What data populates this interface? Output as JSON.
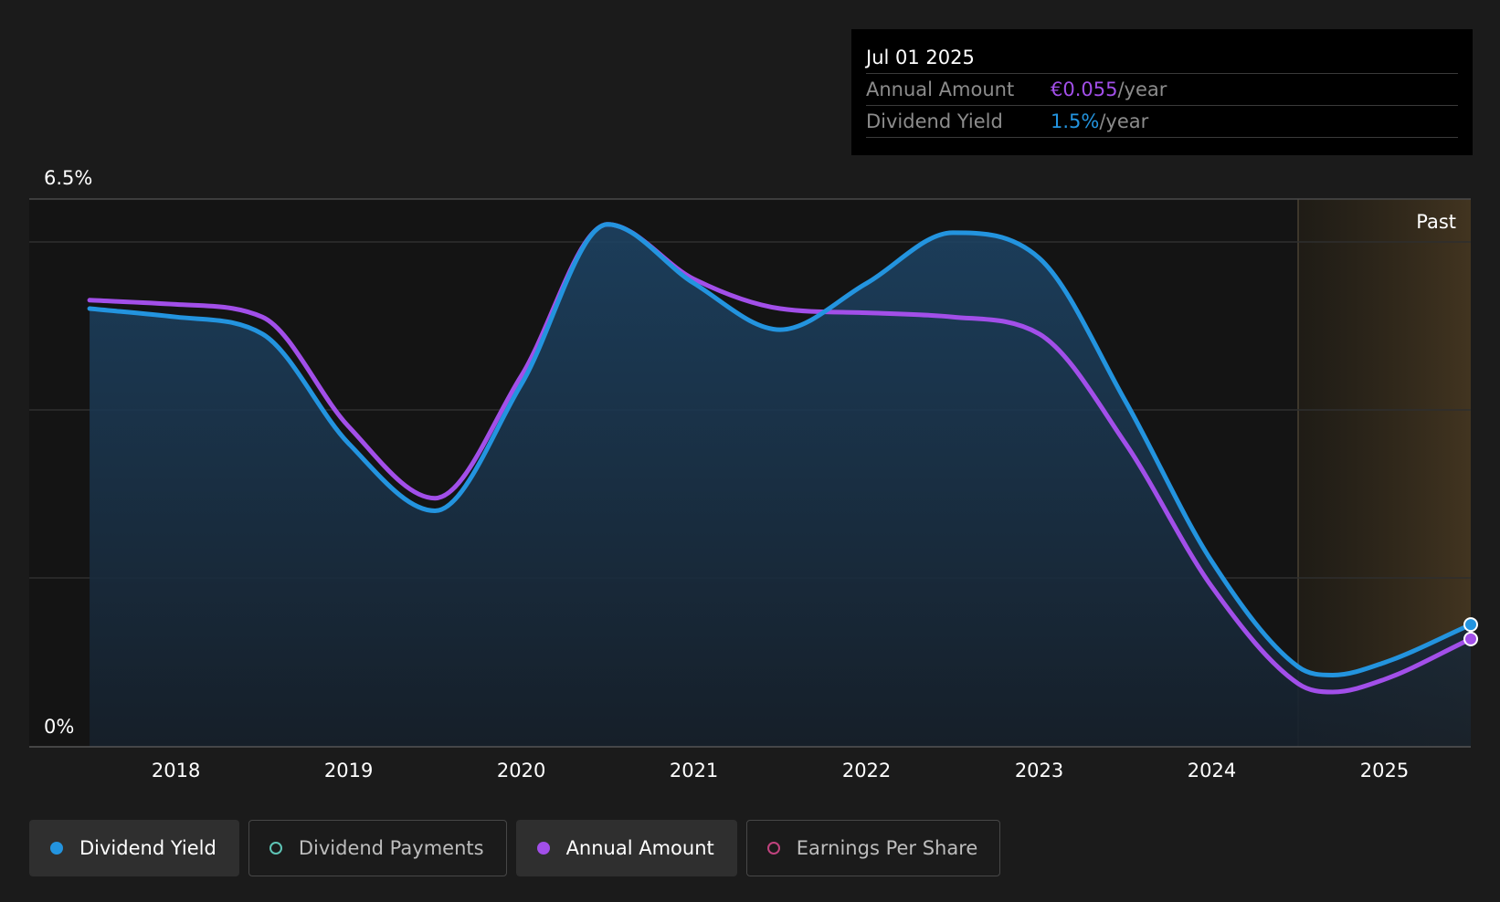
{
  "chart_data": {
    "type": "line",
    "y_axis": {
      "top_label": "6.5%",
      "bottom_label": "0%",
      "ylim": [
        0,
        6.5
      ]
    },
    "x_axis": {
      "tick_labels": [
        "2018",
        "2019",
        "2020",
        "2021",
        "2022",
        "2023",
        "2024",
        "2025"
      ],
      "xlim": [
        2017.15,
        2025.5
      ]
    },
    "past_label": "Past",
    "past_region_start": 2024.5,
    "series": [
      {
        "name": "Dividend Yield",
        "color": "#2394df",
        "filled": true,
        "points": [
          [
            2017.5,
            5.2
          ],
          [
            2018.0,
            5.1
          ],
          [
            2018.5,
            4.9
          ],
          [
            2019.0,
            3.6
          ],
          [
            2019.5,
            2.8
          ],
          [
            2020.0,
            4.3
          ],
          [
            2020.5,
            6.2
          ],
          [
            2021.0,
            5.5
          ],
          [
            2021.5,
            4.95
          ],
          [
            2022.0,
            5.5
          ],
          [
            2022.5,
            6.1
          ],
          [
            2023.0,
            5.8
          ],
          [
            2023.5,
            4.1
          ],
          [
            2024.0,
            2.2
          ],
          [
            2024.5,
            0.95
          ],
          [
            2024.7,
            0.85
          ],
          [
            2025.0,
            1.0
          ],
          [
            2025.5,
            1.45
          ]
        ]
      },
      {
        "name": "Annual Amount",
        "color": "#a24fe9",
        "filled": false,
        "points": [
          [
            2017.5,
            5.3
          ],
          [
            2018.0,
            5.25
          ],
          [
            2018.5,
            5.1
          ],
          [
            2019.0,
            3.8
          ],
          [
            2019.5,
            2.95
          ],
          [
            2020.0,
            4.4
          ],
          [
            2020.5,
            6.2
          ],
          [
            2021.0,
            5.55
          ],
          [
            2021.5,
            5.2
          ],
          [
            2022.0,
            5.15
          ],
          [
            2022.5,
            5.1
          ],
          [
            2023.0,
            4.9
          ],
          [
            2023.5,
            3.6
          ],
          [
            2024.0,
            1.9
          ],
          [
            2024.5,
            0.75
          ],
          [
            2024.7,
            0.65
          ],
          [
            2025.0,
            0.8
          ],
          [
            2025.5,
            1.28
          ]
        ]
      }
    ]
  },
  "tooltip": {
    "date": "Jul 01 2025",
    "rows": [
      {
        "label": "Annual Amount",
        "value": "€0.055",
        "unit": "/year",
        "color": "#a24fe9"
      },
      {
        "label": "Dividend Yield",
        "value": "1.5%",
        "unit": "/year",
        "color": "#2394df"
      }
    ]
  },
  "legend": [
    {
      "label": "Dividend Yield",
      "color": "#2394df",
      "active": true,
      "filled": true
    },
    {
      "label": "Dividend Payments",
      "color": "#5ec4b6",
      "active": false,
      "filled": false
    },
    {
      "label": "Annual Amount",
      "color": "#a24fe9",
      "active": true,
      "filled": true
    },
    {
      "label": "Earnings Per Share",
      "color": "#c0437e",
      "active": false,
      "filled": false
    }
  ]
}
